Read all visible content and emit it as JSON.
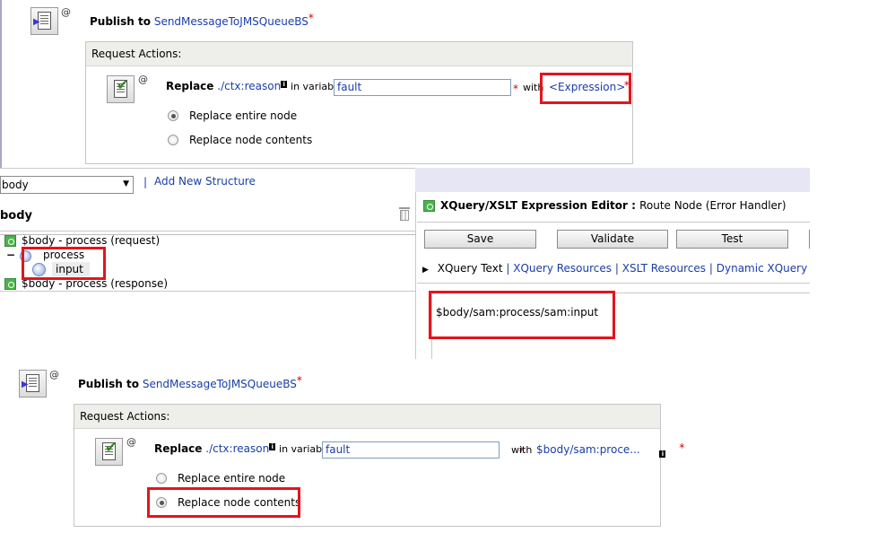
{
  "top_action": {
    "publish_label": "Publish to",
    "service": "SendMessageToJMSQueueBS",
    "request_actions_title": "Request Actions:",
    "replace_label": "Replace",
    "xpath": "./ctx:reason",
    "in_variable_label": "in variable",
    "variable_value": "fault",
    "with_label": "with",
    "expression_link": "<Expression>",
    "radio_entire": "Replace entire node",
    "radio_contents": "Replace node contents",
    "selected": "Replace entire node"
  },
  "variable_browser": {
    "select_value": "body",
    "add_structure_link": "Add New Structure",
    "title": "body",
    "tree": [
      {
        "label": "$body - process (request)"
      },
      {
        "label": "process"
      },
      {
        "label": "input"
      },
      {
        "label": "$body - process (response)"
      }
    ]
  },
  "editor": {
    "title": "XQuery/XSLT Expression Editor",
    "subtitle": "Route Node (Error Handler)",
    "buttons": {
      "save": "Save",
      "validate": "Validate",
      "test": "Test"
    },
    "tabs": {
      "xquery_text": "XQuery Text",
      "xquery_resources": "XQuery Resources",
      "xslt_resources": "XSLT Resources",
      "dynamic_xquery": "Dynamic XQuery"
    },
    "expression": "$body/sam:process/sam:input"
  },
  "bottom_action": {
    "publish_label": "Publish to",
    "service": "SendMessageToJMSQueueBS",
    "request_actions_title": "Request Actions:",
    "replace_label": "Replace",
    "xpath": "./ctx:reason",
    "in_variable_label": "in variable",
    "variable_value": "fault",
    "with_label": "with",
    "expression_value": "$body/sam:proce...",
    "radio_entire": "Replace entire node",
    "radio_contents": "Replace node contents",
    "selected": "Replace node contents"
  },
  "symbols": {
    "required": "*",
    "at": "@",
    "info": "i",
    "separator": "|",
    "collapse": "−",
    "dropdown_arrow": "▼",
    "expand_arrow": "▶"
  },
  "colors": {
    "highlight": "#e5141c",
    "link": "#1a3ea8",
    "required": "#d40000"
  }
}
